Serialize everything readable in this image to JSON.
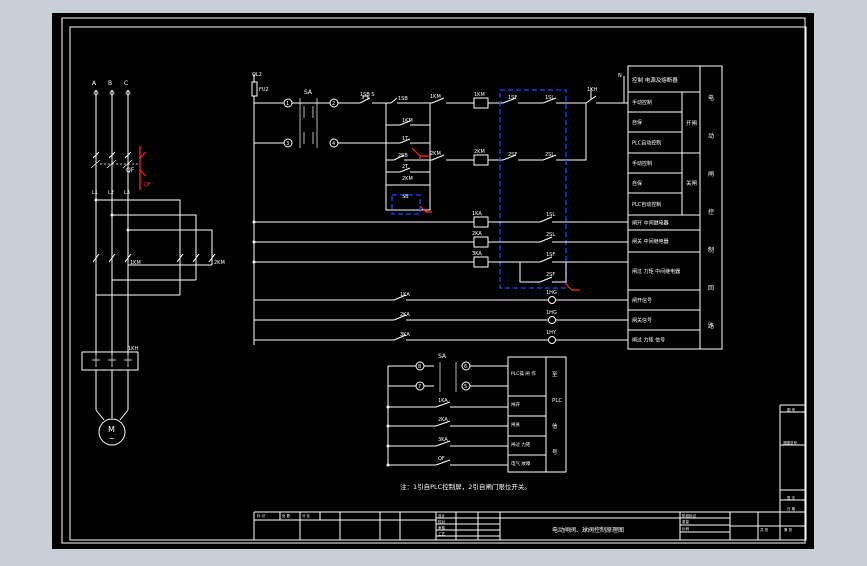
{
  "colors": {
    "page_bg": "#c9cfd6",
    "sheet_bg": "#000000",
    "line": "#ffffff",
    "plc_box": "#2740ff",
    "marker": "#ff2a2a"
  },
  "power": {
    "phases": [
      "A",
      "B",
      "C"
    ],
    "qf": "QF",
    "qf_red": "QF",
    "l_labels": [
      "L1",
      "L2",
      "L3"
    ],
    "km1": "1KM",
    "km2": "2KM",
    "kh": "1KH",
    "motor_m": "M",
    "motor_sub": "~"
  },
  "control": {
    "fuse": "FU2",
    "fuse_top": "QL2",
    "sa": "SA",
    "nodes": [
      "1",
      "2",
      "3",
      "4"
    ],
    "sbs": "1SB S",
    "row1": [
      "1SB",
      "1KM",
      "1KM",
      "1SF",
      "1SL",
      "1KH"
    ],
    "row1_under": "1KM",
    "row2": [
      "2SB",
      "2KM",
      "2SF",
      "2SL"
    ],
    "kt_a": "1T",
    "kt_b": "2T",
    "row2_under": "2KM",
    "sb": "SB",
    "relay_rows": [
      {
        "coil": "1KA",
        "contact": "1SL"
      },
      {
        "coil": "2KA",
        "contact": "2SL"
      },
      {
        "coil": "3KA",
        "contact": "1SF"
      }
    ],
    "row6_contact": "2SF",
    "lamps": [
      {
        "coil": "1KA",
        "lamp": "1HG"
      },
      {
        "coil": "2KA",
        "lamp": "1HG"
      },
      {
        "coil": "3KA",
        "lamp": "1HY"
      }
    ],
    "n_label": "N"
  },
  "right_table": {
    "header": "控制 电源及熔断器",
    "rows": [
      "手动控制",
      "自保",
      "PLC自动控制",
      "手动控制",
      "自保",
      "PLC自动控制",
      "闸开 中间继电器",
      "闸关 中间继电器",
      "闸过 力矩 中间继电器",
      "闸开信号",
      "闸关信号",
      "闸过 力矩 信号"
    ],
    "groups": [
      "开闸",
      "关闸"
    ],
    "side": [
      "电",
      "动",
      "闸",
      "控",
      "制",
      "回",
      "路"
    ]
  },
  "plc_section": {
    "sa": "SA",
    "nodes": [
      "5",
      "6",
      "7",
      "8"
    ],
    "contacts": [
      "1KA",
      "2KA",
      "3KA",
      "QF"
    ],
    "labels": [
      "PLC操 闸 作",
      "闸开",
      "闸关",
      "闸过 力矩",
      "电气 故障"
    ],
    "side": [
      "至",
      "PLC",
      "信",
      "号"
    ]
  },
  "note": "注：1引自PLC控制屏，2引自闸门限位开关。",
  "title_block": {
    "title": "电动闸阀、球阀控制原理图",
    "small_cells": [
      "标 记",
      "处 数",
      "分 区",
      "更改文件号",
      "签 名",
      "年 月 日",
      "设计",
      "校对",
      "审核",
      "工艺",
      "标准化",
      "批准",
      "阶段标记",
      "重量",
      "比例",
      "共 张",
      "第 张"
    ]
  },
  "margin_labels": [
    "图 号",
    "底图总号",
    "签 字",
    "日 期"
  ]
}
